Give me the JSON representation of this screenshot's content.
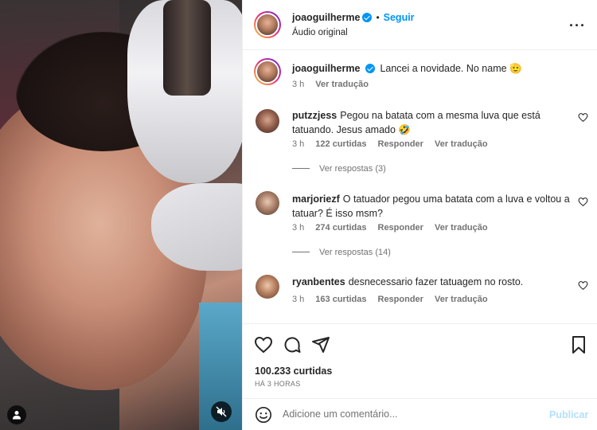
{
  "post": {
    "author": "joaoguilherme",
    "follow_label": "Seguir",
    "dot": "•",
    "audio": "Áudio original",
    "more": "···"
  },
  "caption": {
    "username": "joaoguilherme",
    "text": "Lancei a novidade. No name 🫡",
    "time": "3 h",
    "translate": "Ver tradução"
  },
  "comments": [
    {
      "username": "putzzjess",
      "text": "Pegou na batata com a mesma luva que está tatuando. Jesus amado 🤣",
      "time": "3 h",
      "likes": "122 curtidas",
      "reply": "Responder",
      "translate": "Ver tradução",
      "replies": "Ver respostas (3)"
    },
    {
      "username": "marjoriezf",
      "text": "O tatuador pegou uma batata com a luva e voltou a tatuar? É isso msm?",
      "time": "3 h",
      "likes": "274 curtidas",
      "reply": "Responder",
      "translate": "Ver tradução",
      "replies": "Ver respostas (14)"
    },
    {
      "username": "ryanbentes",
      "text": "desnecessario fazer tatuagem no rosto.",
      "time": "3 h",
      "likes": "163 curtidas",
      "reply": "Responder",
      "translate": "Ver tradução"
    }
  ],
  "footer": {
    "likes": "100.233 curtidas",
    "ago": "HÁ 3 HORAS"
  },
  "composer": {
    "placeholder": "Adicione um comentário...",
    "publish": "Publicar"
  },
  "colors": {
    "accent": "#0095f6",
    "muted": "#737373",
    "text": "#262626",
    "publish_disabled": "#b2dffc"
  },
  "icons": [
    "user-tag-icon",
    "muted-audio-icon",
    "heart-icon",
    "comment-icon",
    "share-icon",
    "bookmark-icon",
    "emoji-icon",
    "more-options-icon",
    "verified-icon"
  ]
}
